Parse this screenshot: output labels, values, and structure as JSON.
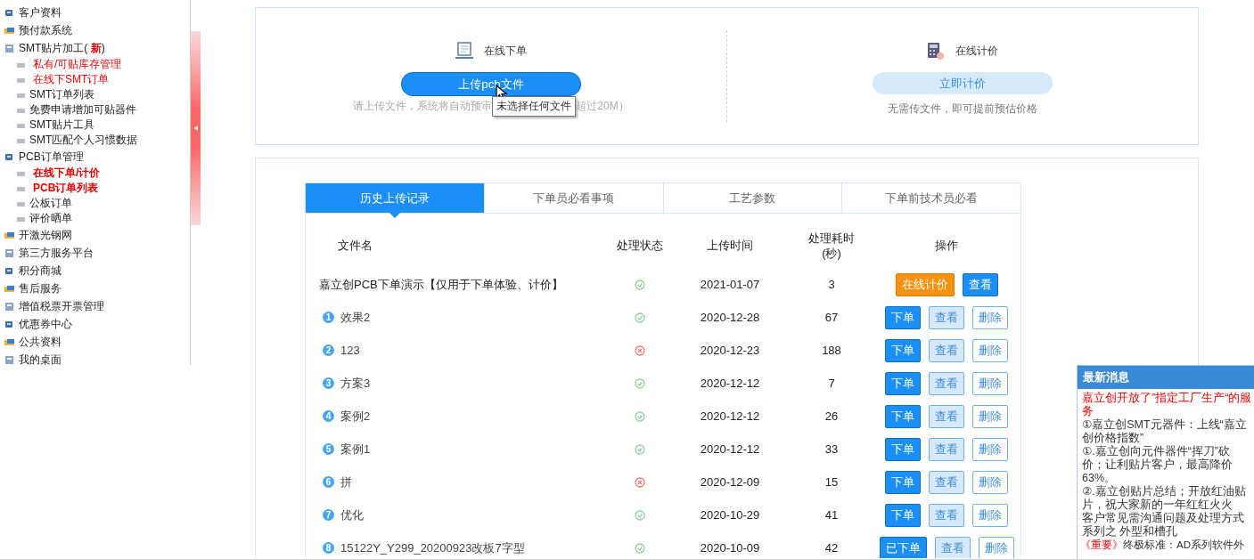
{
  "sidebar": {
    "items": [
      {
        "label": "客户资料",
        "highlighted": false,
        "bold": false
      },
      {
        "label": "预付款系统",
        "highlighted": false,
        "bold": false
      },
      {
        "label": "SMT贴片加工( **新**)",
        "highlighted": false,
        "bold": false,
        "children": [
          {
            "label": "私有/可贴库存管理",
            "highlighted": true,
            "bold": false
          },
          {
            "label": "在线下SMT订单",
            "highlighted": true,
            "bold": false
          },
          {
            "label": "SMT订单列表",
            "highlighted": false,
            "bold": false
          },
          {
            "label": "免费申请增加可贴器件",
            "highlighted": false,
            "bold": false
          },
          {
            "label": "SMT贴片工具",
            "highlighted": false,
            "bold": false
          },
          {
            "label": "SMT匹配个人习惯数据",
            "highlighted": false,
            "bold": false
          }
        ]
      },
      {
        "label": "PCB订单管理",
        "highlighted": false,
        "bold": false,
        "children": [
          {
            "label": "在线下单/计价",
            "highlighted": true,
            "bold": true
          },
          {
            "label": "PCB订单列表",
            "highlighted": true,
            "bold": true
          },
          {
            "label": "公板订单",
            "highlighted": false,
            "bold": false
          },
          {
            "label": "评价晒单",
            "highlighted": false,
            "bold": false
          }
        ]
      },
      {
        "label": "开激光钢网",
        "highlighted": false,
        "bold": false
      },
      {
        "label": "第三方服务平台",
        "highlighted": false,
        "bold": false
      },
      {
        "label": "积分商城",
        "highlighted": false,
        "bold": false
      },
      {
        "label": "售后服务",
        "highlighted": false,
        "bold": false
      },
      {
        "label": "增值税票开票管理",
        "highlighted": false,
        "bold": false
      },
      {
        "label": "优惠券中心",
        "highlighted": false,
        "bold": false
      },
      {
        "label": "公共资料",
        "highlighted": false,
        "bold": false
      },
      {
        "label": "我的桌面",
        "highlighted": false,
        "bold": false
      }
    ]
  },
  "upload": {
    "order": {
      "title": "在线下单",
      "button": "上传pcb文件",
      "hint_before": "请上传文件，系统将自动预审",
      "hint_after": "超过20M）",
      "tooltip": "未选择任何文件"
    },
    "quote": {
      "title": "在线计价",
      "button": "立即计价",
      "hint": "无需传文件，即可提前预估价格"
    }
  },
  "tabs": [
    {
      "label": "历史上传记录",
      "selected": true
    },
    {
      "label": "下单员必看事项",
      "selected": false
    },
    {
      "label": "工艺参数",
      "selected": false
    },
    {
      "label": "下单前技术员必看",
      "selected": false
    }
  ],
  "table": {
    "columns": [
      "文件名",
      "处理状态",
      "上传时间",
      "处理耗时(秒)",
      "操作"
    ],
    "rows": [
      {
        "name": "嘉立创PCB下单演示【仅用于下单体验、计价】",
        "failed": false,
        "date": "2021-01-07",
        "duration": "3",
        "actions": [
          {
            "kind": "price",
            "label": "在线计价"
          },
          {
            "kind": "view-solid",
            "label": "查看"
          }
        ]
      },
      {
        "index": "1",
        "name": "效果2",
        "failed": false,
        "date": "2020-12-28",
        "duration": "67",
        "actions": [
          {
            "kind": "order",
            "label": "下单"
          },
          {
            "kind": "view",
            "label": "查看"
          },
          {
            "kind": "delete",
            "label": "删除"
          }
        ]
      },
      {
        "index": "2",
        "name": "123",
        "failed": true,
        "date": "2020-12-23",
        "duration": "188",
        "actions": [
          {
            "kind": "order",
            "label": "下单"
          },
          {
            "kind": "view",
            "label": "查看"
          },
          {
            "kind": "delete",
            "label": "删除"
          }
        ]
      },
      {
        "index": "3",
        "name": "方案3",
        "failed": false,
        "date": "2020-12-12",
        "duration": "7",
        "actions": [
          {
            "kind": "order",
            "label": "下单"
          },
          {
            "kind": "view",
            "label": "查看"
          },
          {
            "kind": "delete",
            "label": "删除"
          }
        ]
      },
      {
        "index": "4",
        "name": "案例2",
        "failed": false,
        "date": "2020-12-12",
        "duration": "26",
        "actions": [
          {
            "kind": "order",
            "label": "下单"
          },
          {
            "kind": "view",
            "label": "查看"
          },
          {
            "kind": "delete",
            "label": "删除"
          }
        ]
      },
      {
        "index": "5",
        "name": "案例1",
        "failed": false,
        "date": "2020-12-12",
        "duration": "33",
        "actions": [
          {
            "kind": "order",
            "label": "下单"
          },
          {
            "kind": "view",
            "label": "查看"
          },
          {
            "kind": "delete",
            "label": "删除"
          }
        ]
      },
      {
        "index": "6",
        "name": "拼",
        "failed": true,
        "date": "2020-12-09",
        "duration": "15",
        "actions": [
          {
            "kind": "order",
            "label": "下单"
          },
          {
            "kind": "view",
            "label": "查看"
          },
          {
            "kind": "delete",
            "label": "删除"
          }
        ]
      },
      {
        "index": "7",
        "name": "优化",
        "failed": false,
        "date": "2020-10-29",
        "duration": "41",
        "actions": [
          {
            "kind": "order",
            "label": "下单"
          },
          {
            "kind": "view",
            "label": "查看"
          },
          {
            "kind": "delete",
            "label": "删除"
          }
        ]
      },
      {
        "index": "8",
        "name": "15122Y_Y299_20200923改板7字型",
        "failed": false,
        "date": "2020-10-09",
        "duration": "42",
        "actions": [
          {
            "kind": "order",
            "label": "已下单"
          },
          {
            "kind": "view",
            "label": "查看"
          },
          {
            "kind": "delete",
            "label": "删除"
          }
        ]
      }
    ]
  },
  "news": {
    "title": "最新消息",
    "items": [
      {
        "kind": "headline",
        "text": "嘉立创开放了”指定工厂生产“的服务"
      },
      {
        "kind": "normal",
        "text": "①嘉立创SMT元器件：上线“嘉立创价格指数”"
      },
      {
        "kind": "normal",
        "text": "①.嘉立创向元件器件“挥刀”砍价；让利贴片客户，最高降价63%。"
      },
      {
        "kind": "normal",
        "text": "②.嘉立创贴片总结；开放红油贴片，祝大家新的一年红红火火"
      },
      {
        "kind": "normal",
        "text": "客户常见需沟通问题及处理方式系列之 外型和槽孔"
      },
      {
        "kind": "tagged",
        "tag": "《重要》",
        "text": "终极标准：AD系列软件外"
      }
    ]
  }
}
